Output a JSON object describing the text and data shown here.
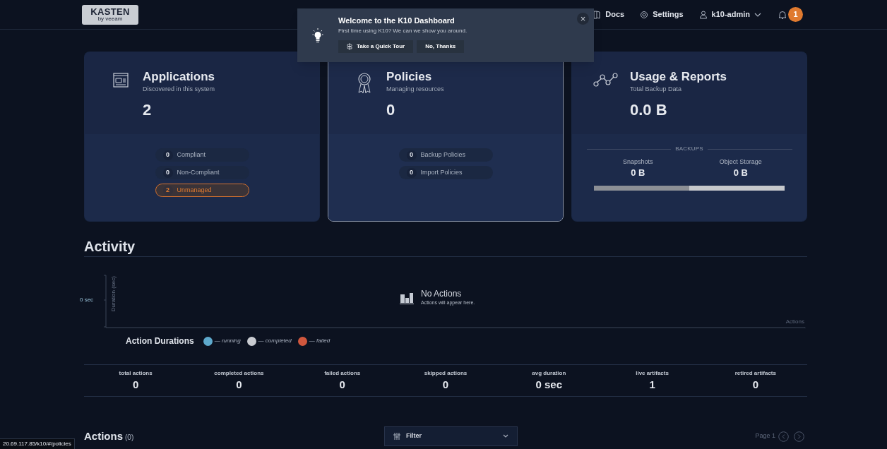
{
  "header": {
    "logo": {
      "name": "KASTEN",
      "sub": "by veeam"
    },
    "nav": [
      {
        "kind": "docs",
        "label": "Docs"
      },
      {
        "kind": "settings",
        "label": "Settings"
      },
      {
        "kind": "user",
        "label": "k10-admin"
      }
    ],
    "notifications": {
      "count": "1"
    }
  },
  "welcome": {
    "title": "Welcome to the K10 Dashboard",
    "text": "First time using K10? We can we show you around.",
    "buttons": [
      {
        "kind": "tour",
        "label": "Take a Quick Tour"
      },
      {
        "kind": "plain",
        "label": "No, Thanks"
      }
    ],
    "close": "×"
  },
  "cards": [
    {
      "kind": "applications",
      "title": "Applications",
      "subtitle": "Discovered in this system",
      "value": "2",
      "selected": false,
      "badges": [
        {
          "count": "0",
          "label": "Compliant",
          "highlighted": false
        },
        {
          "count": "0",
          "label": "Non-Compliant",
          "highlighted": false
        },
        {
          "count": "2",
          "label": "Unmanaged",
          "highlighted": true
        }
      ]
    },
    {
      "kind": "policies",
      "title": "Policies",
      "subtitle": "Managing resources",
      "value": "0",
      "selected": true,
      "badges": [
        {
          "count": "0",
          "label": "Backup Policies",
          "highlighted": false
        },
        {
          "count": "0",
          "label": "Import Policies",
          "highlighted": false
        }
      ]
    },
    {
      "kind": "usage",
      "title": "Usage & Reports",
      "subtitle": "Total Backup Data",
      "value": "0.0 B",
      "selected": false,
      "backups": {
        "heading": "BACKUPS",
        "items": [
          {
            "label": "Snapshots",
            "value": "0 B"
          },
          {
            "label": "Object Storage",
            "value": "0 B"
          }
        ],
        "level": 0.5
      }
    }
  ],
  "activity": {
    "title": "Activity",
    "chart": {
      "y_tick": "0 sec",
      "y_label": "Duration (sec)",
      "x_label": "Actions"
    },
    "empty": {
      "title": "No Actions",
      "text": "Actions will appear here."
    },
    "legend": {
      "title": "Action Durations",
      "items": [
        {
          "label": "— running",
          "color": "#5ea9cc"
        },
        {
          "label": "— completed",
          "color": "#c9ccd1"
        },
        {
          "label": "— failed",
          "color": "#d0573d"
        }
      ]
    },
    "stats": [
      {
        "label": "total actions",
        "value": "0"
      },
      {
        "label": "completed actions",
        "value": "0"
      },
      {
        "label": "failed actions",
        "value": "0"
      },
      {
        "label": "skipped actions",
        "value": "0"
      },
      {
        "label": "avg duration",
        "value": "0 sec"
      },
      {
        "label": "live artifacts",
        "value": "1"
      },
      {
        "label": "retired artifacts",
        "value": "0"
      }
    ]
  },
  "actions": {
    "title": "Actions",
    "count": "(0)",
    "filter": "Filter",
    "page": "Page 1"
  },
  "status_url": "20.69.117.85/k10/#/policies"
}
